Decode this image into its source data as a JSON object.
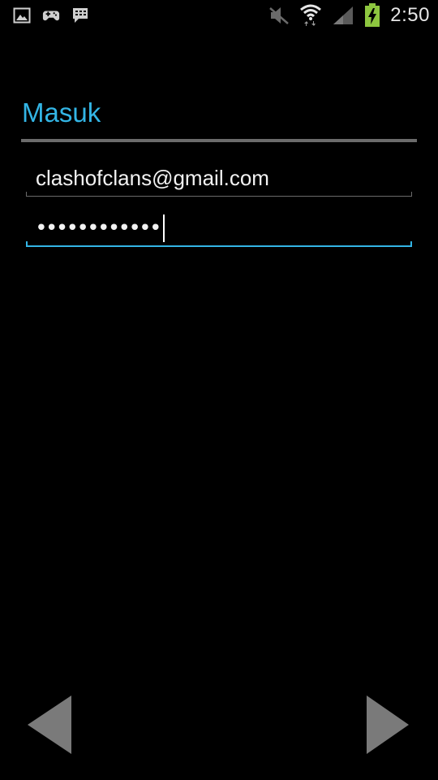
{
  "status_bar": {
    "time": "2:50",
    "icons_left": [
      "image-notification-icon",
      "gamepad-notification-icon",
      "bbm-notification-icon"
    ],
    "icons_right": [
      "muted-volume-icon",
      "wifi-icon",
      "signal-icon",
      "battery-charging-icon"
    ],
    "battery_color": "#8dc63f"
  },
  "page": {
    "title": "Masuk",
    "accent_color": "#33b5e5"
  },
  "form": {
    "email_value": "clashofclans@gmail.com",
    "password_masked": "••••••••••••"
  },
  "nav": {
    "prev_icon": "left-arrow-icon",
    "next_icon": "right-arrow-icon"
  }
}
